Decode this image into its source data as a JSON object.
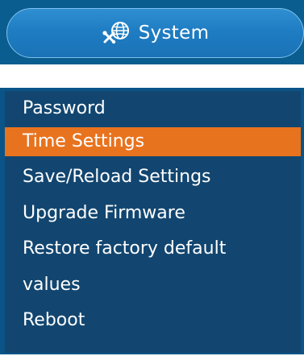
{
  "header": {
    "label": "System",
    "icon": "tools-globe-icon"
  },
  "menu": {
    "items": [
      {
        "label": "Password",
        "active": false
      },
      {
        "label": "Time Settings",
        "active": true
      },
      {
        "label": "Save/Reload Settings",
        "active": false
      },
      {
        "label": "Upgrade Firmware",
        "active": false
      },
      {
        "label": "Restore factory default",
        "label_line2": "values",
        "active": false
      },
      {
        "label": "Reboot",
        "active": false
      }
    ]
  },
  "colors": {
    "header_band": "#0a5d8f",
    "header_pill": "#1f7dc3",
    "menu_background": "#124670",
    "active_item": "#e8731e",
    "text": "#ffffff"
  }
}
